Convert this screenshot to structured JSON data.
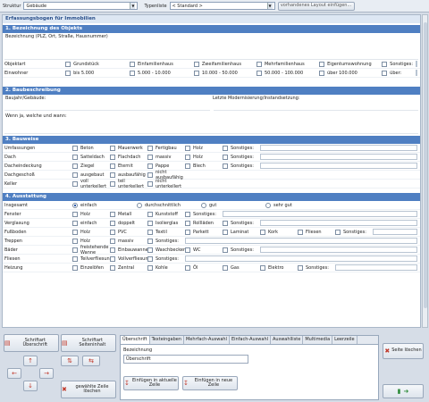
{
  "toolbar": {
    "struktur_label": "Struktur",
    "struktur_value": "Gebäude",
    "typenliste_label": "Typenliste",
    "typenliste_value": "< Standard >",
    "layout_button": "vorhandenes Layout einfügen..."
  },
  "doc_title": "Erfassungsbogen für Immobilien",
  "sections": {
    "s1": {
      "title": "1. Bezeichnung des Objekts",
      "field": "Bezeichnung (PLZ, Ort, Straße, Hausnummer)",
      "rows": [
        {
          "label": "Objektart",
          "options": [
            "Grundstück",
            "Einfamilienhaus",
            "Zweifamilienhaus",
            "Mehrfamilienhaus",
            "Eigentumswohnung",
            "Sonstiges:"
          ]
        },
        {
          "label": "Einwohner",
          "options": [
            "bis 5.000",
            "5.000 - 10.000",
            "10.000 - 50.000",
            "50.000 - 100.000",
            "über 100.000",
            "über:"
          ]
        }
      ]
    },
    "s2": {
      "title": "2. Baubeschreibung",
      "field_left": "Baujahr/Gebäude:",
      "field_right": "Letzte Modernisierung/Instandsetzung:",
      "field_when": "Wenn ja, welche und wann:"
    },
    "s3": {
      "title": "3. Bauweise",
      "rows": [
        {
          "label": "Umfassungen",
          "options": [
            "Beton",
            "Mauerwerk",
            "Fertigbau",
            "Holz",
            "Sonstiges:"
          ]
        },
        {
          "label": "Dach",
          "options": [
            "Satteldach",
            "Flachdach",
            "massiv",
            "Holz",
            "Sonstiges:"
          ]
        },
        {
          "label": "Dacheindeckung",
          "options": [
            "Ziegel",
            "Eternit",
            "Pappe",
            "Blech",
            "Sonstiges:"
          ]
        },
        {
          "label": "Dachgeschoß",
          "options": [
            "ausgebaut",
            "ausbaufähig",
            "nicht ausbaufähig"
          ]
        },
        {
          "label": "Keller",
          "options": [
            "voll unterkellert",
            "teil unterkellert",
            "nicht unterkellert"
          ]
        }
      ]
    },
    "s4": {
      "title": "4. Ausstattung",
      "insgesamt": {
        "label": "Insgesamt",
        "options": [
          "einfach",
          "durchschnittlich",
          "gut",
          "sehr gut"
        ]
      },
      "rows": [
        {
          "label": "Fenster",
          "options": [
            "Holz",
            "Metall",
            "Kunststoff",
            "Sonstiges:"
          ]
        },
        {
          "label": "Verglasung",
          "options": [
            "einfach",
            "doppelt",
            "Isolierglas",
            "Rollläden",
            "Sonstiges:"
          ]
        },
        {
          "label": "Fußboden",
          "options": [
            "Holz",
            "PVC",
            "Textil",
            "Parkett",
            "Laminat",
            "Kork",
            "Fliesen",
            "Sonstiges:"
          ]
        },
        {
          "label": "Treppen",
          "options": [
            "Holz",
            "massiv",
            "Sonstiges:"
          ]
        },
        {
          "label": "Bäder",
          "options": [
            "freistehende Wanne",
            "Einbauwanne",
            "Waschbecken",
            "WC",
            "Sonstiges:"
          ]
        },
        {
          "label": "Fliesen",
          "options": [
            "Teilverfliesung",
            "Vollverfliesung",
            "Sonstiges:"
          ]
        },
        {
          "label": "Heizung",
          "options": [
            "Einzelöfen",
            "Zentral",
            "Kohle",
            "Öl",
            "Gas",
            "Elektro",
            "Sonstiges:"
          ]
        }
      ]
    }
  },
  "controls": {
    "schriftart_ueberschrift": "Schriftart Überschrift",
    "schriftart_seiteninhalt": "Schriftart Seiteninhalt",
    "gewaehlte_zeile_loeschen": "gewählte Zeile löschen",
    "seite_loeschen": "Seite löschen"
  },
  "tabs": [
    "Überschrift",
    "Texteingaben",
    "Mehrfach-Auswahl",
    "Einfach-Auswahl",
    "Auswahlliste",
    "Multimedia",
    "Leerzeile"
  ],
  "tab_panel": {
    "bezeichnung_label": "Bezeichnung",
    "bezeichnung_value": "Überschrift",
    "einfuegen_aktuelle": "Einfügen in aktuelle Zeile",
    "einfuegen_neue": "Einfügen in neue Zeile"
  },
  "colors": {
    "section": "#4f7fc2",
    "title_text": "#2a4f8a",
    "accent_red": "#c0392b"
  }
}
